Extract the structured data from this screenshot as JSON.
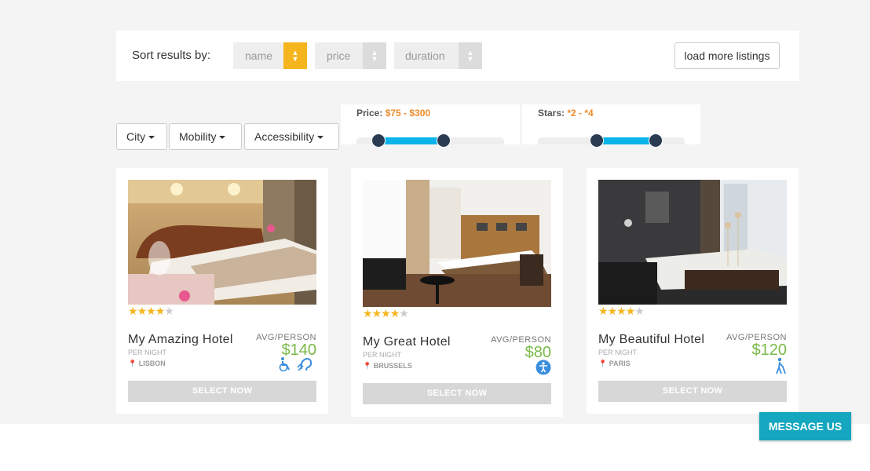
{
  "sort": {
    "label": "Sort results by:",
    "options": [
      {
        "label": "name",
        "active": true
      },
      {
        "label": "price",
        "active": false
      },
      {
        "label": "duration",
        "active": false
      }
    ],
    "load_more": "load more listings"
  },
  "filters": {
    "city": "City",
    "mobility": "Mobility",
    "accessibility": "Accessibility",
    "price": {
      "label": "Price:",
      "value": "$75 - $300",
      "min_fraction": 0.15,
      "max_fraction": 0.59
    },
    "stars": {
      "label": "Stars:",
      "value": "*2 - *4",
      "min_fraction": 0.4,
      "max_fraction": 0.8
    }
  },
  "hotels": [
    {
      "name": "My Amazing Hotel",
      "per_night": "PER NIGHT",
      "city": "LISBON",
      "avg_label": "AVG/PERSON",
      "price": "$140",
      "rating": 4,
      "amenities": [
        "wheelchair-icon",
        "hearing-assist-icon"
      ],
      "select": "SELECT NOW"
    },
    {
      "name": "My Great Hotel",
      "per_night": "PER NIGHT",
      "city": "BRUSSELS",
      "avg_label": "AVG/PERSON",
      "price": "$80",
      "rating": 4,
      "amenities": [
        "accessibility-icon"
      ],
      "select": "SELECT NOW"
    },
    {
      "name": "My Beautiful Hotel",
      "per_night": "PER NIGHT",
      "city": "PARIS",
      "avg_label": "AVG/PERSON",
      "price": "$120",
      "rating": 4,
      "amenities": [
        "blind-cane-icon"
      ],
      "select": "SELECT NOW"
    }
  ],
  "message_button": "MESSAGE US",
  "colors": {
    "accent": "#f5b51d",
    "price": "#7ab948",
    "slider": "#0ab4ea",
    "message": "#14a7bf"
  }
}
